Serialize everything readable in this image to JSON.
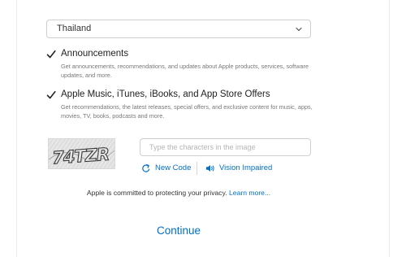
{
  "country": {
    "selected": "Thailand"
  },
  "options": [
    {
      "title": "Announcements",
      "description": "Get announcements, recommendations, and updates about Apple products, services, software updates, and more.",
      "checked": true
    },
    {
      "title": "Apple Music, iTunes, iBooks, and App Store Offers",
      "description": "Get recommendations, the latest releases, special offers, and exclusive content for music, apps, movies, TV, books, podcasts and more.",
      "checked": true
    }
  ],
  "captcha": {
    "image_text": "74TZR",
    "placeholder": "Type the characters in the image",
    "new_code_label": "New Code",
    "vision_impaired_label": "Vision Impaired"
  },
  "privacy": {
    "text": "Apple is committed to protecting your privacy.",
    "link_label": "Learn more..."
  },
  "continue_label": "Continue",
  "colors": {
    "accent": "#0070c9"
  }
}
